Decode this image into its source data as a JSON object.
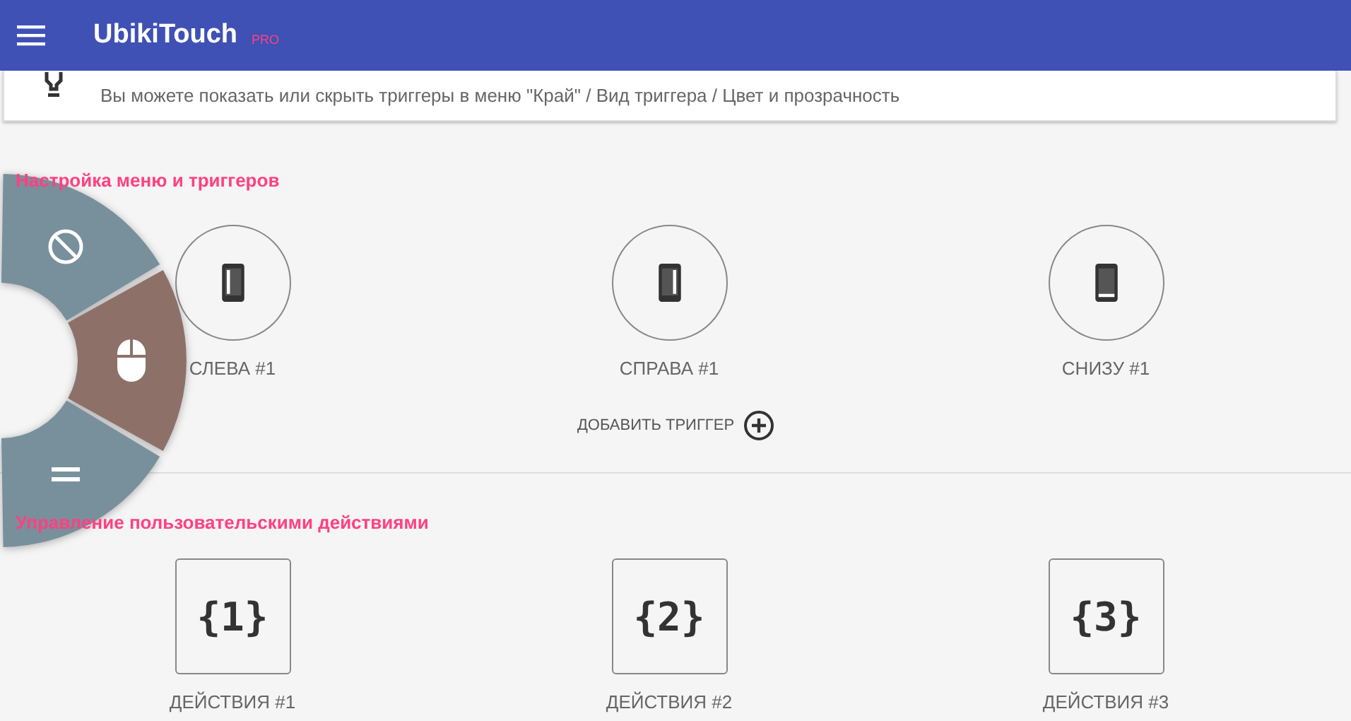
{
  "app_bar": {
    "title": "UbikiTouch",
    "badge": "PRO"
  },
  "hint": {
    "text": "Вы можете показать или скрыть триггеры в меню \"Край\" / Вид триггера / Цвет и прозрачность"
  },
  "triggers_section": {
    "title": "Настройка меню и триггеров",
    "triggers": [
      {
        "label": "СЛЕВА #1",
        "kind": "left"
      },
      {
        "label": "СПРАВА #1",
        "kind": "right"
      },
      {
        "label": "СНИЗУ #1",
        "kind": "bottom"
      }
    ],
    "add_button": "ДОБАВИТЬ ТРИГГЕР"
  },
  "actions_section": {
    "title": "Управление пользовательскими действиями",
    "actions": [
      {
        "glyph": "{1}",
        "label": "ДЕЙСТВИЯ #1"
      },
      {
        "glyph": "{2}",
        "label": "ДЕЙСТВИЯ #2"
      },
      {
        "glyph": "{3}",
        "label": "ДЕЙСТВИЯ #3"
      }
    ]
  },
  "pie_menu": {
    "segments": [
      {
        "kind": "block",
        "selected": false
      },
      {
        "kind": "mouse",
        "selected": true
      },
      {
        "kind": "menu",
        "selected": false
      }
    ]
  }
}
